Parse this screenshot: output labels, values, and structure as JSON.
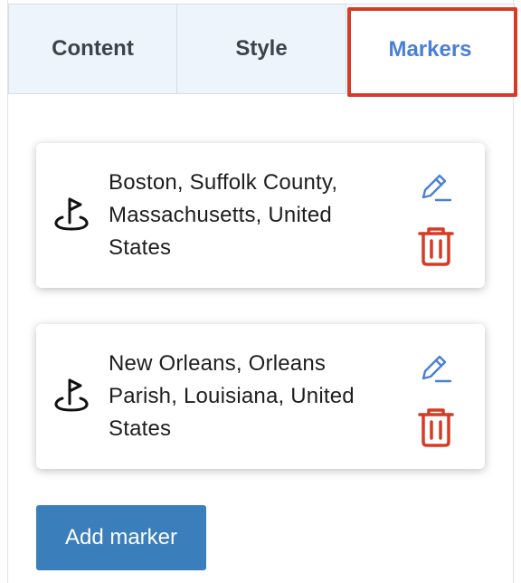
{
  "tabs": [
    {
      "label": "Content"
    },
    {
      "label": "Style"
    },
    {
      "label": "Markers"
    }
  ],
  "active_tab": "Markers",
  "markers": [
    {
      "label": "Boston, Suffolk County, Massachusetts, United States",
      "icon": "map-pin-icon"
    },
    {
      "label": "New Orleans, Orleans Parish, Louisiana, United States",
      "icon": "map-pin-icon"
    }
  ],
  "add_button": {
    "label": "Add marker"
  },
  "colors": {
    "accent": "#4a7fd6",
    "delete": "#d63b26",
    "highlight": "#d63b26",
    "button": "#3a7fbb"
  }
}
